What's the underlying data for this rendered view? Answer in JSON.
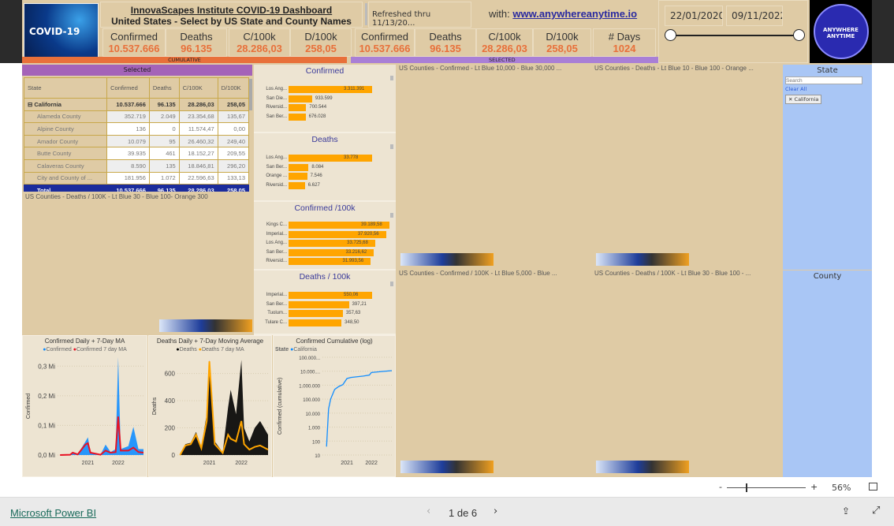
{
  "header": {
    "title": "InnovaScapes Institute COVID-19 Dashboard",
    "subtitle": "United States - Select by US State and County Names",
    "refreshed": "Refreshed thru 11/13/20...",
    "with_label": "with:",
    "link": "www.anywhereanytime.io",
    "logo_text": "COVID-19",
    "brand_logo_text": "ANYWHERE ANYTIME"
  },
  "kpis_cumulative": [
    {
      "label": "Confirmed",
      "value": "10.537.666"
    },
    {
      "label": "Deaths",
      "value": "96.135"
    },
    {
      "label": "C/100k",
      "value": "28.286,03"
    },
    {
      "label": "D/100k",
      "value": "258,05"
    }
  ],
  "kpis_selected": [
    {
      "label": "Confirmed",
      "value": "10.537.666"
    },
    {
      "label": "Deaths",
      "value": "96.135"
    },
    {
      "label": "C/100k",
      "value": "28.286,03"
    },
    {
      "label": "D/100k",
      "value": "258,05"
    },
    {
      "label": "# Days",
      "value": "1024"
    }
  ],
  "bands": {
    "cumulative": "CUMULATIVE",
    "selected": "SELECTED"
  },
  "date_slicer": {
    "start": "22/01/2020",
    "end": "09/11/2022"
  },
  "table": {
    "title": "Selected",
    "columns": [
      "State",
      "Confirmed",
      "Deaths",
      "C/100K",
      "D/100K"
    ],
    "state_row": [
      "California",
      "10.537.666",
      "96.135",
      "28.286,03",
      "258,05"
    ],
    "rows": [
      [
        "Alameda County",
        "352.719",
        "2.049",
        "23.354,68",
        "135,67"
      ],
      [
        "Alpine County",
        "136",
        "0",
        "11.574,47",
        "0,00"
      ],
      [
        "Amador County",
        "10.079",
        "95",
        "26.460,32",
        "249,40"
      ],
      [
        "Butte County",
        "39.935",
        "461",
        "18.152,27",
        "209,55"
      ],
      [
        "Calaveras County",
        "8.590",
        "135",
        "18.846,81",
        "296,20"
      ],
      [
        "City and County of ...",
        "181.956",
        "1.072",
        "22.596,63",
        "133,13"
      ]
    ],
    "total_row": [
      "Total",
      "10.537.666",
      "96.135",
      "28.286,03",
      "258,05"
    ]
  },
  "bar_charts": [
    {
      "title": "Confirmed",
      "items": [
        {
          "name": "Los Ang...",
          "label": "3.311.391",
          "value": 3311391
        },
        {
          "name": "San Die...",
          "label": "933.599",
          "value": 933599
        },
        {
          "name": "Riversid...",
          "label": "700.544",
          "value": 700544
        },
        {
          "name": "San Ber...",
          "label": "676.028",
          "value": 676028
        }
      ]
    },
    {
      "title": "Deaths",
      "items": [
        {
          "name": "Los Ang...",
          "label": "33.778",
          "value": 33778
        },
        {
          "name": "San Ber...",
          "label": "8.084",
          "value": 8084
        },
        {
          "name": "Orange ...",
          "label": "7.546",
          "value": 7546
        },
        {
          "name": "Riversid...",
          "label": "6.627",
          "value": 6627
        }
      ]
    },
    {
      "title": "Confirmed /100k",
      "items": [
        {
          "name": "Kings C...",
          "label": "39.189,58",
          "value": 39189.58
        },
        {
          "name": "Imperial...",
          "label": "37.920,56",
          "value": 37920.56
        },
        {
          "name": "Los Ang...",
          "label": "33.725,68",
          "value": 33725.68
        },
        {
          "name": "San Ber...",
          "label": "33.216,62",
          "value": 33216.62
        },
        {
          "name": "Riversid...",
          "label": "31.993,56",
          "value": 31993.56
        }
      ]
    },
    {
      "title": "Deaths / 100k",
      "items": [
        {
          "name": "Imperial...",
          "label": "550,06",
          "value": 550.06
        },
        {
          "name": "San Ber...",
          "label": "397,21",
          "value": 397.21
        },
        {
          "name": "Tuolum...",
          "label": "357,63",
          "value": 357.63
        },
        {
          "name": "Tulare C...",
          "label": "348,50",
          "value": 348.5
        }
      ]
    }
  ],
  "maps": {
    "deaths_100k_left": "US Counties - Deaths / 100K - Lt Blue 30 - Blue 100- Orange 300",
    "confirmed": "US Counties - Confirmed - Lt Blue 10,000 - Blue 30,000 ...",
    "deaths": "US Counties - Deaths - Lt Blue 10 - Blue 100 - Orange ...",
    "confirmed_100k": "US Counties - Confirmed / 100K - Lt Blue 5,000  - Blue ...",
    "deaths_100k": "US Counties - Deaths / 100K - Lt Blue 30  - Blue 100 - ..."
  },
  "state_slicer": {
    "title": "State",
    "search_placeholder": "Search",
    "clear_all": "Clear All",
    "selected": "California"
  },
  "county_slicer": {
    "title": "County"
  },
  "chart_data": [
    {
      "type": "area",
      "title": "Confirmed Daily + 7-Day MA",
      "ylabel": "Confirmed",
      "yticks": [
        "0,0 Mi",
        "0,1 Mi",
        "0,2 Mi",
        "0,3 Mi"
      ],
      "ylim": [
        0,
        0.33
      ],
      "xticks": [
        "2021",
        "2022"
      ],
      "series": [
        {
          "name": "Confirmed",
          "color": "#118dff",
          "x": [
            "2020-02",
            "2020-06",
            "2020-07",
            "2020-09",
            "2020-12",
            "2021-01",
            "2021-02",
            "2021-06",
            "2021-08",
            "2021-10",
            "2021-12",
            "2022-01",
            "2022-02",
            "2022-05",
            "2022-07",
            "2022-09",
            "2022-11"
          ],
          "values": [
            0,
            0.002,
            0.01,
            0.003,
            0.045,
            0.06,
            0.01,
            0.001,
            0.035,
            0.01,
            0.02,
            0.33,
            0.02,
            0.03,
            0.095,
            0.02,
            0.02
          ]
        },
        {
          "name": "Confirmed 7 day MA",
          "color": "#e81123",
          "x": [
            "2020-02",
            "2020-06",
            "2020-07",
            "2020-09",
            "2020-12",
            "2021-01",
            "2021-02",
            "2021-06",
            "2021-08",
            "2021-10",
            "2021-12",
            "2022-01",
            "2022-02",
            "2022-05",
            "2022-07",
            "2022-09",
            "2022-11"
          ],
          "values": [
            0,
            0.001,
            0.008,
            0.002,
            0.035,
            0.04,
            0.008,
            0.001,
            0.015,
            0.008,
            0.01,
            0.13,
            0.015,
            0.015,
            0.025,
            0.01,
            0.008
          ]
        }
      ]
    },
    {
      "type": "area",
      "title": "Deaths Daily + 7-Day Moving Average",
      "ylabel": "Deaths",
      "yticks": [
        "0",
        "200",
        "400",
        "600"
      ],
      "ylim": [
        0,
        720
      ],
      "xticks": [
        "2021",
        "2022"
      ],
      "series": [
        {
          "name": "Deaths",
          "color": "#000000",
          "x": [
            "2020-02",
            "2020-04",
            "2020-06",
            "2020-08",
            "2020-10",
            "2020-12",
            "2021-01",
            "2021-03",
            "2021-06",
            "2021-08",
            "2021-09",
            "2021-11",
            "2022-01",
            "2022-02",
            "2022-04",
            "2022-06",
            "2022-08",
            "2022-11"
          ],
          "values": [
            0,
            80,
            90,
            170,
            60,
            300,
            700,
            100,
            20,
            350,
            480,
            300,
            700,
            200,
            100,
            200,
            250,
            150
          ]
        },
        {
          "name": "Deaths 7 day MA",
          "color": "#ffa500",
          "x": [
            "2020-02",
            "2020-04",
            "2020-06",
            "2020-08",
            "2020-10",
            "2020-12",
            "2021-01",
            "2021-03",
            "2021-06",
            "2021-08",
            "2021-09",
            "2021-11",
            "2022-01",
            "2022-02",
            "2022-04",
            "2022-06",
            "2022-08",
            "2022-11"
          ],
          "values": [
            0,
            70,
            80,
            150,
            50,
            250,
            690,
            80,
            15,
            150,
            120,
            100,
            250,
            80,
            40,
            60,
            70,
            40
          ]
        }
      ]
    },
    {
      "type": "line",
      "title": "Confirmed Cumulative (log)",
      "legend_title": "State",
      "ylabel": "Confirmed (cumulative)",
      "yscale": "log",
      "yticks": [
        "10",
        "100",
        "1.000",
        "10.000",
        "100.000",
        "1.000.000",
        "10.000....",
        "100.000..."
      ],
      "xticks": [
        "2021",
        "2022"
      ],
      "series": [
        {
          "name": "California",
          "color": "#118dff",
          "x": [
            "2020-03",
            "2020-04",
            "2020-05",
            "2020-07",
            "2020-09",
            "2020-11",
            "2021-01",
            "2021-03",
            "2021-09",
            "2021-12",
            "2022-01",
            "2022-06",
            "2022-11"
          ],
          "values": [
            40,
            20000,
            100000,
            500000,
            800000,
            1100000,
            3000000,
            3600000,
            4500000,
            5200000,
            8000000,
            9500000,
            11000000
          ]
        }
      ]
    }
  ],
  "footer": {
    "zoom": "56%",
    "zoom_minus": "-",
    "zoom_plus": "+",
    "brand": "Microsoft Power BI",
    "page": "1 de 6"
  },
  "colors": {
    "accent_orange": "#e8703a",
    "bar": "#ffa500",
    "total_row": "#1b2c9c",
    "selected_band": "#a97fd6",
    "slicer_bg": "#a9c6f5"
  }
}
